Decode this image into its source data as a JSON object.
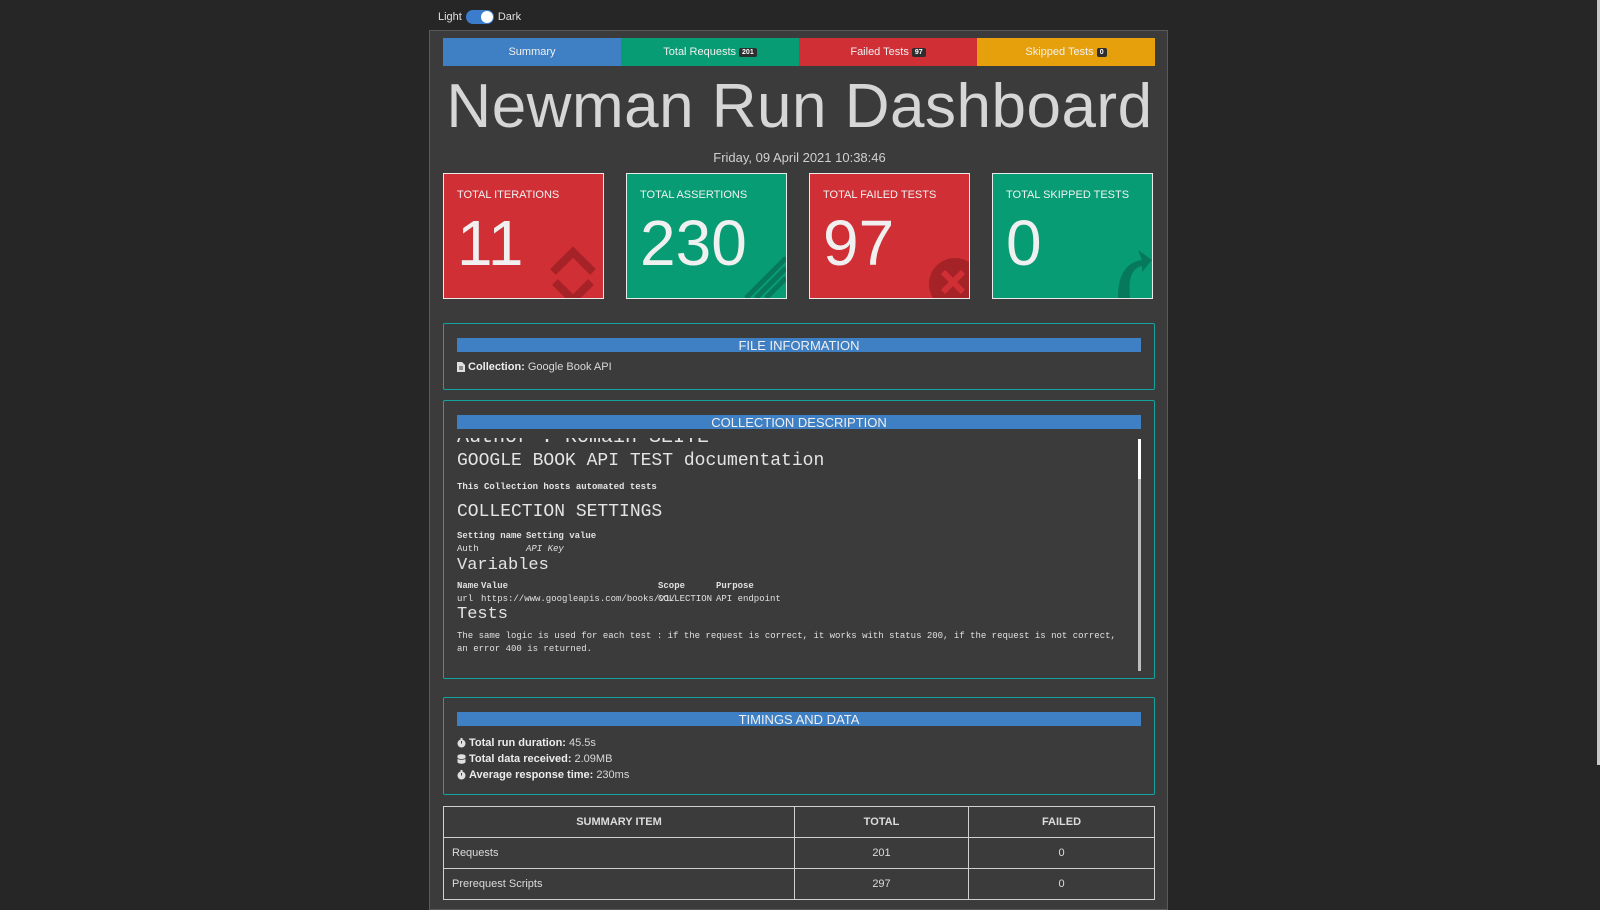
{
  "theme": {
    "light_label": "Light",
    "dark_label": "Dark"
  },
  "tabs": [
    {
      "label": "Summary",
      "badge": ""
    },
    {
      "label": "Total Requests",
      "badge": "201"
    },
    {
      "label": "Failed Tests",
      "badge": "97"
    },
    {
      "label": "Skipped Tests",
      "badge": "0"
    }
  ],
  "title": "Newman Run Dashboard",
  "date": "Friday, 09 April 2021 10:38:46",
  "stats": [
    {
      "label": "TOTAL ITERATIONS",
      "value": "11",
      "icon": "sync-icon"
    },
    {
      "label": "TOTAL ASSERTIONS",
      "value": "230",
      "icon": "checklist-icon"
    },
    {
      "label": "TOTAL FAILED TESTS",
      "value": "97",
      "icon": "times-circle-icon"
    },
    {
      "label": "TOTAL SKIPPED TESTS",
      "value": "0",
      "icon": "share-arrow-icon"
    }
  ],
  "file_info": {
    "heading": "FILE INFORMATION",
    "collection_label": "Collection:",
    "collection_value": "Google Book API"
  },
  "description": {
    "heading": "COLLECTION DESCRIPTION",
    "author_line": "Author : Romain SEITE",
    "doc_title": "GOOGLE BOOK API TEST documentation",
    "intro": "This Collection hosts automated tests",
    "settings_heading": "COLLECTION SETTINGS",
    "settings_cols": [
      "Setting name",
      "Setting value"
    ],
    "settings_row": [
      "Auth",
      "API Key"
    ],
    "variables_heading": "Variables",
    "var_cols": [
      "Name",
      "Value",
      "Scope",
      "Purpose"
    ],
    "var_row": [
      "url",
      "https://www.googleapis.com/books/v1/",
      "COLLECTION",
      "API endpoint"
    ],
    "tests_heading": "Tests",
    "tests_text": "The same logic is used for each test : if the request is correct, it works with status 200, if the request is not correct, an error 400 is returned."
  },
  "timings": {
    "heading": "TIMINGS AND DATA",
    "rows": [
      {
        "label": "Total run duration:",
        "value": "45.5s",
        "icon": "stopwatch-icon"
      },
      {
        "label": "Total data received:",
        "value": "2.09MB",
        "icon": "database-icon"
      },
      {
        "label": "Average response time:",
        "value": "230ms",
        "icon": "stopwatch-icon"
      }
    ]
  },
  "summary_table": {
    "headers": [
      "SUMMARY ITEM",
      "TOTAL",
      "FAILED"
    ],
    "rows": [
      [
        "Requests",
        "201",
        "0"
      ],
      [
        "Prerequest Scripts",
        "297",
        "0"
      ]
    ]
  },
  "colors": {
    "blue": "#3f7fc4",
    "green": "#079c74",
    "red": "#cf2f35",
    "orange": "#e5a00c",
    "background": "#262626",
    "panel": "#3b3b3b",
    "teal_border": "#14a4a0"
  }
}
